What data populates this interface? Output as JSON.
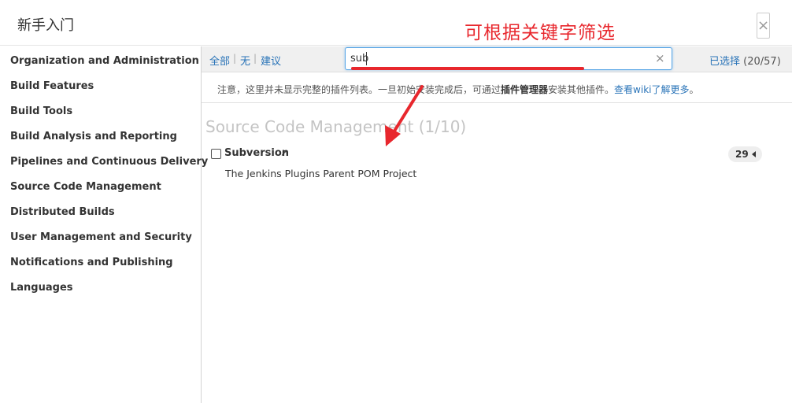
{
  "dialog": {
    "title": "新手入门",
    "close_label": "×",
    "annotation": "可根据关键字筛选"
  },
  "sidebar": {
    "items": [
      {
        "label": "Organization and Administration"
      },
      {
        "label": "Build Features"
      },
      {
        "label": "Build Tools"
      },
      {
        "label": "Build Analysis and Reporting"
      },
      {
        "label": "Pipelines and Continuous Delivery"
      },
      {
        "label": "Source Code Management"
      },
      {
        "label": "Distributed Builds"
      },
      {
        "label": "User Management and Security"
      },
      {
        "label": "Notifications and Publishing"
      },
      {
        "label": "Languages"
      }
    ]
  },
  "toolbar": {
    "all_label": "全部",
    "none_label": "无",
    "suggested_label": "建议",
    "separator": "|",
    "search_value": "sub",
    "clear_label": "×",
    "selected_label": "已选择",
    "selected_count": "(20/57)"
  },
  "notice": {
    "prefix": "注意，这里并未显示完整的插件列表。一旦初始安装完成后，可通过",
    "bold": "插件管理器",
    "middle": "安装其他插件。",
    "link": "查看wiki了解更多",
    "suffix": "。"
  },
  "section": {
    "title": "Source Code Management (1/10)"
  },
  "plugin": {
    "name": "Subversion",
    "ext_icon": "↗",
    "dependency_count": "29",
    "description": "The Jenkins Plugins Parent POM Project",
    "checked": false
  },
  "colors": {
    "accent_link": "#2a74b8",
    "annotation_red": "#e8272d"
  }
}
